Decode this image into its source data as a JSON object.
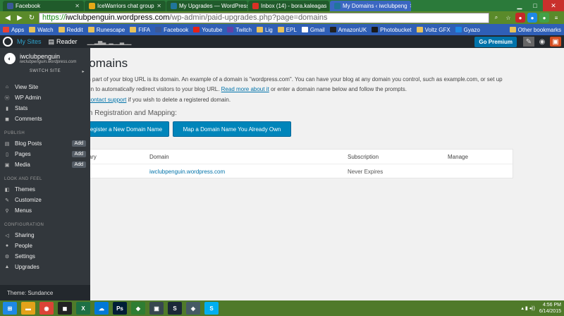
{
  "browser": {
    "tabs": [
      {
        "title": "Facebook",
        "color": "#3b5998",
        "active": false
      },
      {
        "title": "IceWarriors chat group",
        "color": "#e6a817",
        "active": false
      },
      {
        "title": "My Upgrades — WordPress",
        "color": "#21759b",
        "active": false
      },
      {
        "title": "Inbox (14) - bora.kaleagas",
        "color": "#d93025",
        "active": false
      },
      {
        "title": "My Domains ‹ iwclubpeng",
        "color": "#21759b",
        "active": true
      }
    ],
    "url_scheme": "https://",
    "url_host": "iwclubpenguin.wordpress.com",
    "url_path": "/wp-admin/paid-upgrades.php?page=domains",
    "bookmarks": [
      "Apps",
      "Watch",
      "Reddit",
      "Runescape",
      "FIFA",
      "Facebook",
      "Youtube",
      "Twitch",
      "Lig",
      "EPL",
      "Gmail",
      "AmazonUK",
      "Photobucket",
      "Voltz GFX",
      "Gyazo"
    ],
    "other_bookmarks": "Other bookmarks"
  },
  "wpbar": {
    "my_sites": "My Sites",
    "reader": "Reader",
    "go_premium": "Go Premium"
  },
  "sidebar": {
    "site_name": "iwclubpenguin",
    "site_url": "iwclubpenguin.wordpress.com",
    "switch_site": "SWITCH SITE",
    "top_items": [
      {
        "label": "View Site",
        "icon": "home-icon"
      },
      {
        "label": "WP Admin",
        "icon": "wp-icon"
      },
      {
        "label": "Stats",
        "icon": "stats-icon"
      },
      {
        "label": "Comments",
        "icon": "comment-icon"
      }
    ],
    "publish_header": "PUBLISH",
    "publish_items": [
      {
        "label": "Blog Posts",
        "add": "Add"
      },
      {
        "label": "Pages",
        "add": "Add"
      },
      {
        "label": "Media",
        "add": "Add"
      }
    ],
    "look_header": "LOOK AND FEEL",
    "look_items": [
      "Themes",
      "Customize",
      "Menus"
    ],
    "config_header": "CONFIGURATION",
    "config_items": [
      "Sharing",
      "People",
      "Settings",
      "Upgrades"
    ],
    "theme": "Theme: Sundance"
  },
  "main": {
    "title": "Domains",
    "intro_before": "ain part of your blog URL is its domain. An example of a domain is \"wordpress.com\". You can have your blog at any domain you control, such as example.com, or set up",
    "intro_line2": "nain to automatically redirect visitors to your blog URL.",
    "intro_link": "Read more about it",
    "intro_after": "or enter a domain name below and follow the prompts.",
    "support_before": "e",
    "support_link": "contact support",
    "support_after": "if you wish to delete a registered domain.",
    "registration_title": "ain Registration and Mapping:",
    "btn_register": "egister a New Domain Name",
    "btn_map": "Map a Domain Name You Already Own",
    "table": {
      "headers": [
        "mary",
        "Domain",
        "Subscription",
        "Manage"
      ],
      "rows": [
        [
          "",
          "iwclubpenguin.wordpress.com",
          "Never Expires",
          ""
        ]
      ]
    }
  },
  "taskbar": {
    "time": "4:56 PM",
    "date": "6/14/2015"
  }
}
